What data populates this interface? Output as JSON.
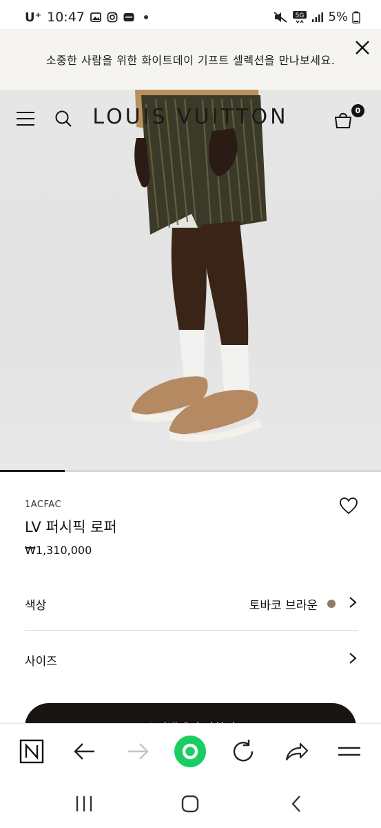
{
  "status_bar": {
    "carrier": "U⁺",
    "time": "10:47",
    "network": "5G",
    "battery": "5%"
  },
  "promo_banner": {
    "text": "소중한 사람을 위한 화이트데이 기프트 셀렉션을 만나보세요."
  },
  "header": {
    "logo": "LOUIS VUITTON",
    "bag_count": "0"
  },
  "carousel": {
    "progress_fraction": 0.17
  },
  "product": {
    "sku": "1ACFAC",
    "name": "LV 퍼시픽 로퍼",
    "price": "₩1,310,000"
  },
  "options": {
    "color_label": "색상",
    "color_value": "토바코 브라운",
    "color_swatch": "#8b7d63",
    "size_label": "사이즈"
  },
  "cta": {
    "label": "쇼핑백에 추가하기"
  },
  "browser_toolbar": {
    "items": [
      "naver-icon",
      "back-arrow-icon",
      "forward-arrow-icon",
      "home-green-icon",
      "refresh-icon",
      "share-icon",
      "menu-icon"
    ]
  },
  "colors": {
    "accent_green": "#19ce60",
    "cta_background": "#191512"
  }
}
